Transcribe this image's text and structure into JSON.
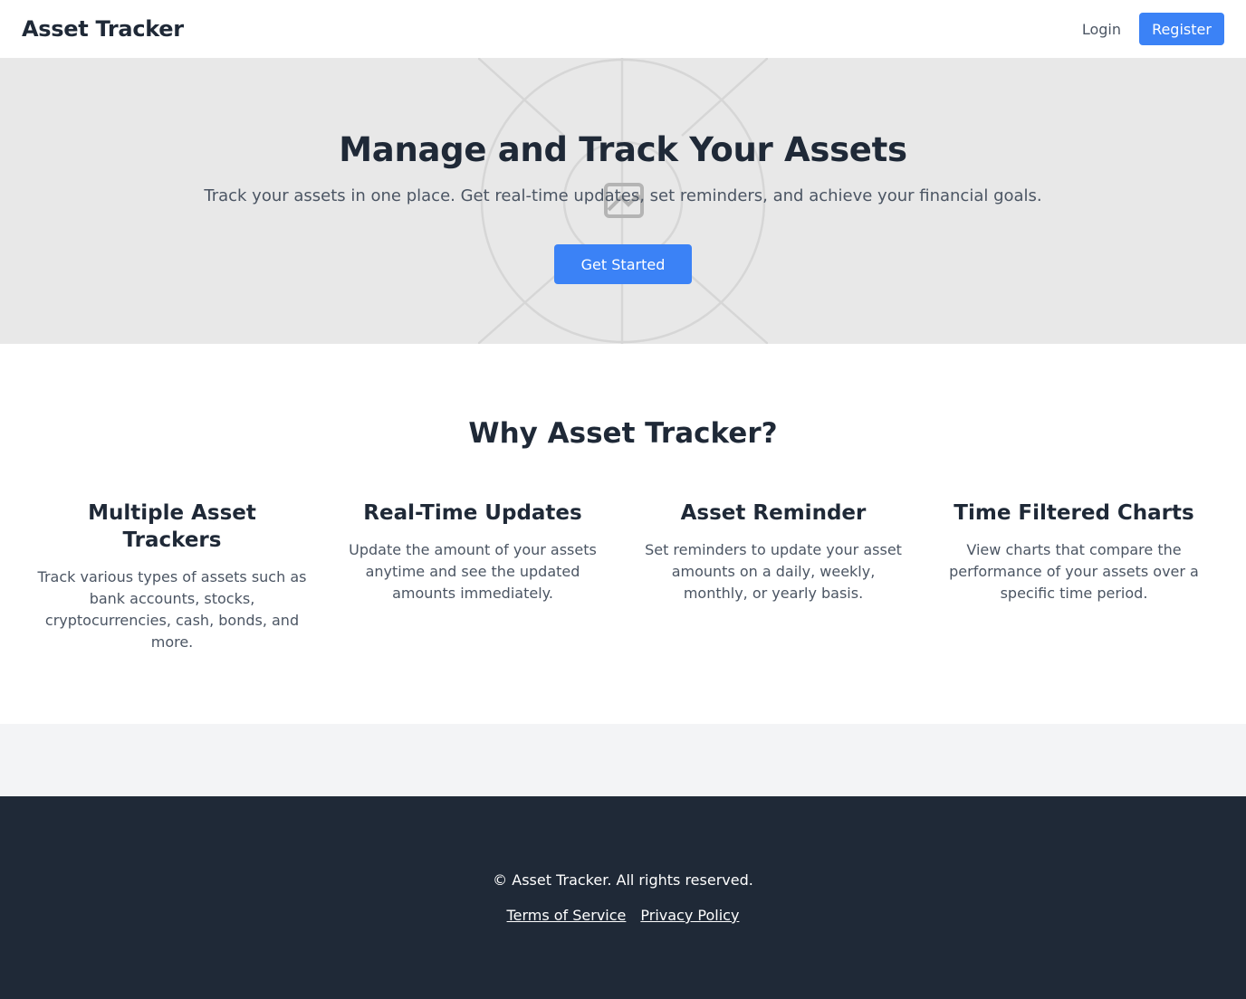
{
  "header": {
    "brand": "Asset Tracker",
    "login_label": "Login",
    "register_label": "Register"
  },
  "hero": {
    "title": "Manage and Track Your Assets",
    "subtitle": "Track your assets in one place. Get real-time updates, set reminders, and achieve your financial goals.",
    "cta_label": "Get Started",
    "background_icon": "image-placeholder-icon"
  },
  "features": {
    "title": "Why Asset Tracker?",
    "items": [
      {
        "title": "Multiple Asset Trackers",
        "description": "Track various types of assets such as bank accounts, stocks, cryptocurrencies, cash, bonds, and more."
      },
      {
        "title": "Real-Time Updates",
        "description": "Update the amount of your assets anytime and see the updated amounts immediately."
      },
      {
        "title": "Asset Reminder",
        "description": "Set reminders to update your asset amounts on a daily, weekly, monthly, or yearly basis."
      },
      {
        "title": "Time Filtered Charts",
        "description": "View charts that compare the performance of your assets over a specific time period."
      }
    ]
  },
  "footer": {
    "copyright": "© Asset Tracker. All rights reserved.",
    "terms_label": "Terms of Service",
    "privacy_label": "Privacy Policy"
  },
  "colors": {
    "accent": "#3b82f6",
    "footer_bg": "#1f2937",
    "hero_bg": "#e8e8e8",
    "band_bg": "#f3f4f6"
  }
}
